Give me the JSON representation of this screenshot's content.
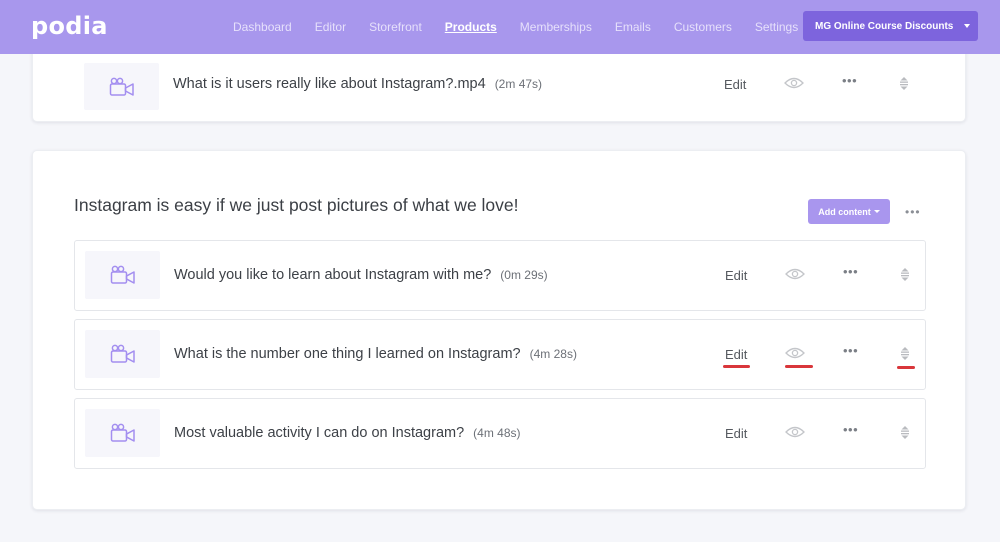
{
  "app": {
    "logo": "podia",
    "nav": [
      {
        "label": "Dashboard",
        "active": false
      },
      {
        "label": "Editor",
        "active": false
      },
      {
        "label": "Storefront",
        "active": false
      },
      {
        "label": "Products",
        "active": true
      },
      {
        "label": "Memberships",
        "active": false
      },
      {
        "label": "Emails",
        "active": false
      },
      {
        "label": "Customers",
        "active": false
      },
      {
        "label": "Settings",
        "active": false
      }
    ],
    "site_switcher": {
      "label": "MG Online Course Discounts",
      "icon": "caret-down-icon"
    },
    "colors": {
      "brand": "#a897ed",
      "brand_dark": "#7d64dd",
      "annotation": "#d9363b"
    }
  },
  "previous_section": {
    "lessons": [
      {
        "title": "What is it users really like about Instagram?.mp4",
        "duration": "(2m 47s)",
        "edit_label": "Edit",
        "icon": "video-camera-icon"
      }
    ]
  },
  "section": {
    "title": "Instagram is easy if we just post pictures of what we love!",
    "add_content_label": "Add content",
    "more_label": "•••",
    "lessons": [
      {
        "title": "Would you like to learn about Instagram with me?",
        "duration": "(0m 29s)",
        "edit_label": "Edit",
        "icon": "video-camera-icon"
      },
      {
        "title": "What is the number one thing I learned on Instagram?",
        "duration": "(4m 28s)",
        "edit_label": "Edit",
        "icon": "video-camera-icon",
        "highlighted": true
      },
      {
        "title": "Most valuable activity I can do on Instagram?",
        "duration": "(4m 48s)",
        "edit_label": "Edit",
        "icon": "video-camera-icon"
      }
    ]
  },
  "row_actions": {
    "more_label": "•••"
  }
}
